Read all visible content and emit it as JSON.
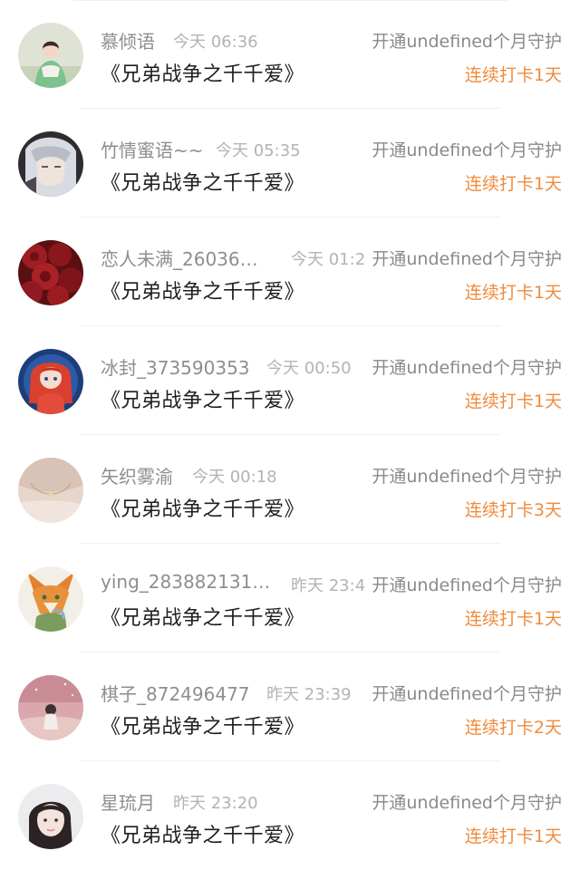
{
  "items": [
    {
      "name": "慕倾语",
      "time": "今天 06:36",
      "action": "开通undefined个月守护",
      "title": "《兄弟战争之千千爱》",
      "streak": "连续打卡1天",
      "avatar": "avatar-girl-green-dress"
    },
    {
      "name": "竹情蜜语~~",
      "time": "今天 05:35",
      "action": "开通undefined个月守护",
      "title": "《兄弟战争之千千爱》",
      "streak": "连续打卡1天",
      "avatar": "avatar-anime-silver-hair"
    },
    {
      "name": "恋人未满_26036…",
      "time": "今天 01:2",
      "action": "开通undefined个月守护",
      "title": "《兄弟战争之千千爱》",
      "streak": "连续打卡1天",
      "avatar": "avatar-red-roses"
    },
    {
      "name": "冰封_373590353",
      "time": "今天 00:50",
      "action": "开通undefined个月守护",
      "title": "《兄弟战争之千千爱》",
      "streak": "连续打卡1天",
      "avatar": "avatar-anime-red-hair"
    },
    {
      "name": "矢织雾渝",
      "time": "今天 00:18",
      "action": "开通undefined个月守护",
      "title": "《兄弟战争之千千爱》",
      "streak": "连续打卡3天",
      "avatar": "avatar-necklace"
    },
    {
      "name": "ying_283882131…",
      "time": "昨天 23:4",
      "action": "开通undefined个月守护",
      "title": "《兄弟战争之千千爱》",
      "streak": "连续打卡1天",
      "avatar": "avatar-fox-cartoon"
    },
    {
      "name": "棋子_872496477",
      "time": "昨天 23:39",
      "action": "开通undefined个月守护",
      "title": "《兄弟战争之千千爱》",
      "streak": "连续打卡2天",
      "avatar": "avatar-pink-sky-girl"
    },
    {
      "name": "星琉月",
      "time": "昨天 23:20",
      "action": "开通undefined个月守护",
      "title": "《兄弟战争之千千爱》",
      "streak": "连续打卡1天",
      "avatar": "avatar-girl-photo"
    }
  ],
  "colors": {
    "streak": "#f08b3c",
    "name": "#8e8e8e",
    "time": "#b3b3b3",
    "action": "#8a8a8a",
    "title": "#1f1f1f"
  }
}
